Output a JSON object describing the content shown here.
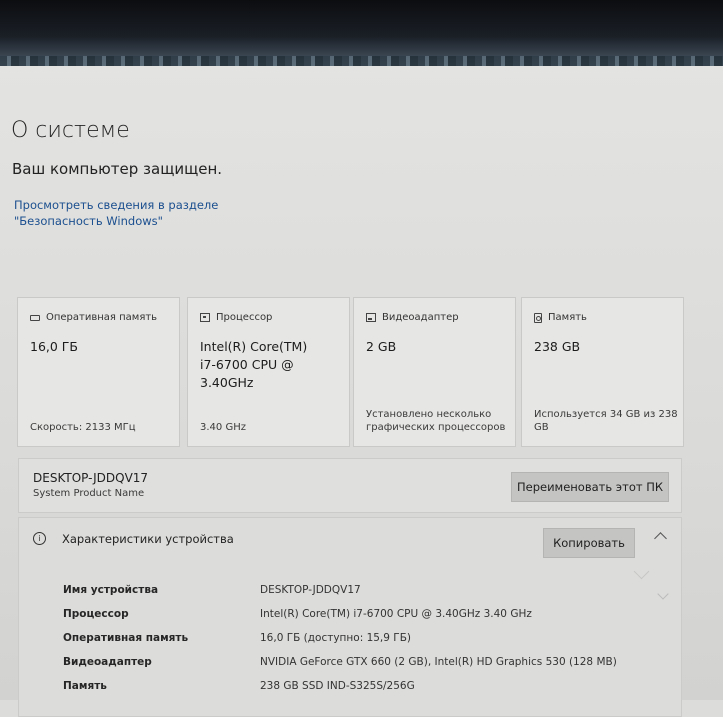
{
  "page": {
    "title": "О системе",
    "protected_text": "Ваш компьютер защищен.",
    "security_link": "Просмотреть сведения в разделе \"Безопасность Windows\""
  },
  "cards": [
    {
      "icon": "ram-icon",
      "label": "Оперативная память",
      "value": "16,0 ГБ",
      "footer": "Скорость: 2133 МГц"
    },
    {
      "icon": "cpu-icon",
      "label": "Процессор",
      "value": "Intel(R) Core(TM) i7-6700 CPU @ 3.40GHz",
      "footer": "3.40 GHz"
    },
    {
      "icon": "gpu-icon",
      "label": "Видеоадаптер",
      "value": "2 GB",
      "footer": "Установлено несколько графических процессоров"
    },
    {
      "icon": "storage-icon",
      "label": "Память",
      "value": "238 GB",
      "footer": "Используется 34 GB из 238 GB"
    }
  ],
  "device": {
    "name": "DESKTOP-JDDQV17",
    "product": "System Product Name",
    "rename_label": "Переименовать этот ПК"
  },
  "specs": {
    "title": "Характеристики устройства",
    "copy_label": "Копировать",
    "rows": [
      {
        "label": "Имя устройства",
        "value": "DESKTOP-JDDQV17"
      },
      {
        "label": "Процессор",
        "value": "Intel(R) Core(TM) i7-6700 CPU @ 3.40GHz   3.40 GHz"
      },
      {
        "label": "Оперативная память",
        "value": "16,0 ГБ (доступно: 15,9 ГБ)"
      },
      {
        "label": "Видеоадаптер",
        "value": "NVIDIA GeForce GTX 660 (2 GB), Intel(R) HD Graphics 530 (128 MB)"
      },
      {
        "label": "Память",
        "value": "238 GB SSD IND-S325S/256G"
      }
    ]
  }
}
